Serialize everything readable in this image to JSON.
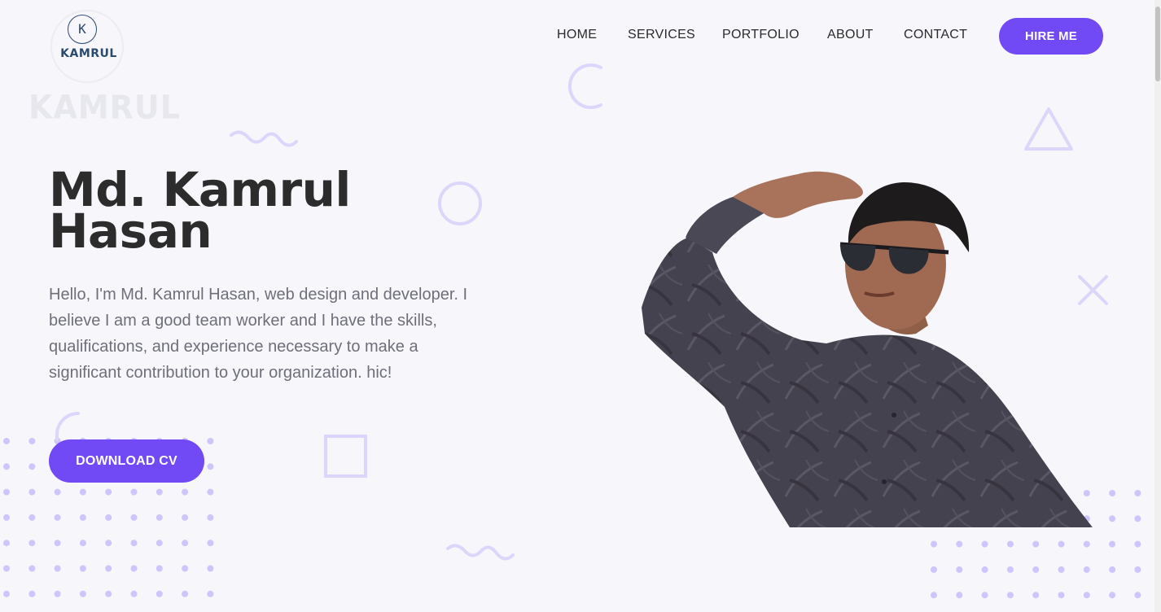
{
  "logo": {
    "initial": "K",
    "name": "KAMRUL",
    "watermark": "KAMRUL"
  },
  "nav": {
    "items": [
      "HOME",
      "SERVICES",
      "PORTFOLIO",
      "ABOUT",
      "CONTACT"
    ],
    "cta": "HIRE ME"
  },
  "hero": {
    "name_line1": "Md. Kamrul",
    "name_line2": "Hasan",
    "bio": "Hello, I'm Md. Kamrul Hasan, web design and developer. I believe I am a good team worker and I have the skills, qualifications, and experience necessary to make a significant contribution to your organization. hic!",
    "cta": "DOWNLOAD CV"
  },
  "colors": {
    "accent": "#7149f5",
    "background": "#f6f6fb",
    "heading": "#2c2c2c",
    "body_text": "#6f6f7a",
    "decor": "#dcd6fb",
    "dots": "#cfc4fb",
    "logo": "#2c4a6e"
  },
  "icons": {
    "decor_shapes": [
      "arc",
      "wave",
      "circle",
      "triangle",
      "x-mark",
      "square",
      "dot-grid"
    ]
  }
}
